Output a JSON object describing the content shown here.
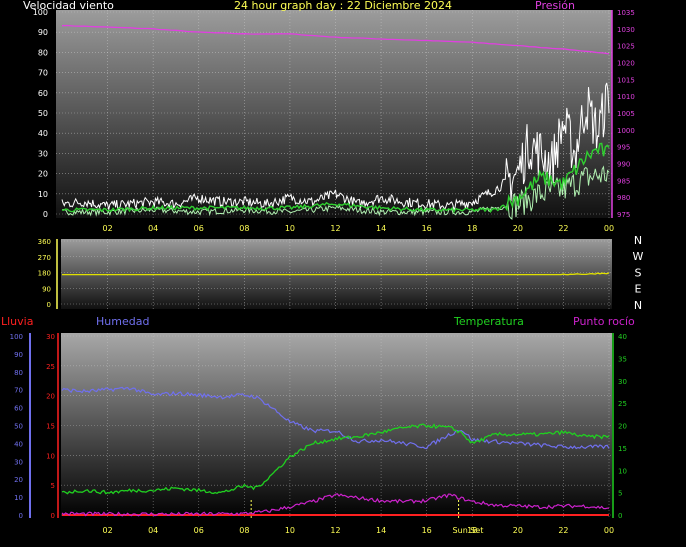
{
  "title": "24 hour graph day : 22 Diciembre 2024",
  "colors": {
    "title": "#ffff55",
    "wind_axis": "#ffffff",
    "pressure": "#e040e0",
    "wind_main": "#ffffff",
    "wind_avg": "#30d030",
    "wind_light": "#b0f0b0",
    "direction": "#e0e000",
    "rain": "#ff2020",
    "humidity": "#7070ee",
    "temperature": "#20d020",
    "dew_point": "#cc22cc",
    "time_axis": "#ffff55",
    "dir_axis": "#ffff55",
    "compass": "#ffffff"
  },
  "time_ticks": [
    "02",
    "04",
    "06",
    "08",
    "10",
    "12",
    "14",
    "16",
    "18",
    "20",
    "22",
    "00"
  ],
  "chart_data": [
    {
      "type": "line",
      "name": "wind_pressure",
      "left_label": "Velocidad viento",
      "right_label": "Presión",
      "left_ticks": [
        "100",
        "90",
        "80",
        "70",
        "60",
        "50",
        "40",
        "30",
        "20",
        "10",
        "0"
      ],
      "right_ticks": [
        "1035",
        "1030",
        "1025",
        "1020",
        "1015",
        "1010",
        "1005",
        "1000",
        "995",
        "990",
        "985",
        "980",
        "975"
      ],
      "ylim_left": [
        0,
        100
      ],
      "ylim_right": [
        975,
        1035
      ],
      "xlim_hours": [
        0,
        24
      ],
      "grid": true,
      "pressure": [
        [
          0,
          1031
        ],
        [
          2,
          1030.5
        ],
        [
          4,
          1030
        ],
        [
          6,
          1029
        ],
        [
          8,
          1028.5
        ],
        [
          10,
          1028.5
        ],
        [
          12,
          1027.5
        ],
        [
          14,
          1027
        ],
        [
          16,
          1026.5
        ],
        [
          18,
          1026
        ],
        [
          20,
          1025
        ],
        [
          22,
          1024
        ],
        [
          23.5,
          1023
        ],
        [
          24,
          1022.5
        ]
      ],
      "gust": [
        [
          0,
          5
        ],
        [
          1,
          6
        ],
        [
          2,
          4
        ],
        [
          3,
          5
        ],
        [
          4,
          6
        ],
        [
          5,
          5
        ],
        [
          6,
          8
        ],
        [
          7,
          6
        ],
        [
          8,
          6
        ],
        [
          9,
          5
        ],
        [
          10,
          8
        ],
        [
          11,
          6
        ],
        [
          12,
          10
        ],
        [
          13,
          5
        ],
        [
          14,
          8
        ],
        [
          15,
          6
        ],
        [
          16,
          5
        ],
        [
          17,
          4
        ],
        [
          18,
          6
        ],
        [
          19,
          12
        ],
        [
          20,
          20
        ],
        [
          20.5,
          35
        ],
        [
          21,
          30
        ],
        [
          21.5,
          25
        ],
        [
          22,
          45
        ],
        [
          22.5,
          30
        ],
        [
          23,
          55
        ],
        [
          23.5,
          40
        ],
        [
          24,
          60
        ]
      ],
      "avg": [
        [
          0,
          2
        ],
        [
          2,
          2
        ],
        [
          4,
          3
        ],
        [
          6,
          3
        ],
        [
          8,
          3
        ],
        [
          10,
          3
        ],
        [
          12,
          5
        ],
        [
          14,
          3
        ],
        [
          16,
          2
        ],
        [
          18,
          2
        ],
        [
          19,
          2
        ],
        [
          20,
          8
        ],
        [
          21,
          18
        ],
        [
          22,
          15
        ],
        [
          23,
          28
        ],
        [
          23.5,
          32
        ],
        [
          24,
          30
        ]
      ],
      "low": [
        [
          0,
          1
        ],
        [
          2,
          1
        ],
        [
          4,
          2
        ],
        [
          6,
          1
        ],
        [
          8,
          2
        ],
        [
          10,
          1
        ],
        [
          12,
          3
        ],
        [
          14,
          1
        ],
        [
          16,
          1
        ],
        [
          18,
          1
        ],
        [
          20,
          5
        ],
        [
          21,
          10
        ],
        [
          22,
          12
        ],
        [
          23,
          18
        ],
        [
          24,
          20
        ]
      ]
    },
    {
      "type": "line",
      "name": "wind_direction",
      "left_ticks": [
        "360",
        "270",
        "180",
        "90",
        "0"
      ],
      "compass": [
        "N",
        "W",
        "S",
        "E",
        "N"
      ],
      "ylim": [
        0,
        360
      ],
      "xlim_hours": [
        0,
        24
      ],
      "grid": true,
      "direction": [
        [
          0,
          168
        ],
        [
          22,
          168
        ],
        [
          22.5,
          172
        ],
        [
          23,
          170
        ],
        [
          23.5,
          175
        ],
        [
          24,
          176
        ]
      ]
    },
    {
      "type": "line",
      "name": "humidity_temperature",
      "rain_label": "Lluvia",
      "humidity_label": "Humedad",
      "temperature_label": "Temperatura",
      "dew_label": "Punto rocío",
      "humidity_ticks": [
        "100",
        "90",
        "80",
        "70",
        "60",
        "50",
        "40",
        "30",
        "20",
        "10",
        "0"
      ],
      "rain_ticks": [
        "30",
        "25",
        "20",
        "15",
        "10",
        "5",
        "0"
      ],
      "temp_ticks": [
        "40",
        "35",
        "30",
        "25",
        "20",
        "15",
        "10",
        "5",
        "0"
      ],
      "ylim_humidity": [
        0,
        100
      ],
      "ylim_rain": [
        0,
        30
      ],
      "ylim_temp": [
        0,
        40
      ],
      "xlim_hours": [
        0,
        24
      ],
      "grid": true,
      "sun_label": "Sun Set",
      "markers_hours": [
        8.3,
        17.4
      ],
      "humidity": [
        [
          0,
          70
        ],
        [
          1,
          69
        ],
        [
          2,
          70
        ],
        [
          3,
          71
        ],
        [
          4,
          67
        ],
        [
          5,
          68
        ],
        [
          6,
          67
        ],
        [
          7,
          66
        ],
        [
          8,
          67
        ],
        [
          8.5,
          66
        ],
        [
          9,
          62
        ],
        [
          10,
          52
        ],
        [
          11,
          47
        ],
        [
          12,
          47
        ],
        [
          13,
          41
        ],
        [
          14,
          42
        ],
        [
          15,
          40
        ],
        [
          16,
          38
        ],
        [
          17,
          45
        ],
        [
          17.5,
          48
        ],
        [
          18,
          42
        ],
        [
          19,
          41
        ],
        [
          20,
          40
        ],
        [
          21,
          39
        ],
        [
          22,
          38
        ],
        [
          23,
          38
        ],
        [
          24,
          38
        ]
      ],
      "temperature": [
        [
          0,
          5
        ],
        [
          1,
          5.5
        ],
        [
          2,
          5
        ],
        [
          3,
          5.5
        ],
        [
          4,
          5.5
        ],
        [
          5,
          6
        ],
        [
          6,
          5.5
        ],
        [
          7,
          5
        ],
        [
          8,
          6.5
        ],
        [
          8.5,
          6
        ],
        [
          9,
          8
        ],
        [
          10,
          13
        ],
        [
          11,
          16
        ],
        [
          12,
          17
        ],
        [
          13,
          17.5
        ],
        [
          14,
          18.5
        ],
        [
          15,
          19.5
        ],
        [
          16,
          20
        ],
        [
          17,
          19.5
        ],
        [
          17.5,
          18.5
        ],
        [
          18,
          16
        ],
        [
          19,
          18
        ],
        [
          20,
          18
        ],
        [
          21,
          18
        ],
        [
          22,
          18.5
        ],
        [
          23,
          17.5
        ],
        [
          24,
          17.5
        ]
      ],
      "dew_point": [
        [
          0,
          0.3
        ],
        [
          2,
          0.2
        ],
        [
          4,
          0.2
        ],
        [
          6,
          0.2
        ],
        [
          8,
          0.3
        ],
        [
          9,
          0.8
        ],
        [
          10,
          1.8
        ],
        [
          11,
          3
        ],
        [
          12,
          4.5
        ],
        [
          13,
          3.8
        ],
        [
          14,
          3.2
        ],
        [
          15,
          3
        ],
        [
          16,
          3.2
        ],
        [
          17,
          4.5
        ],
        [
          18,
          3
        ],
        [
          19,
          2.2
        ],
        [
          20,
          2
        ],
        [
          21,
          1.8
        ],
        [
          22,
          2
        ],
        [
          23,
          2
        ],
        [
          24,
          1.5
        ]
      ],
      "rain": [
        [
          0,
          0
        ],
        [
          24,
          0
        ]
      ]
    }
  ]
}
